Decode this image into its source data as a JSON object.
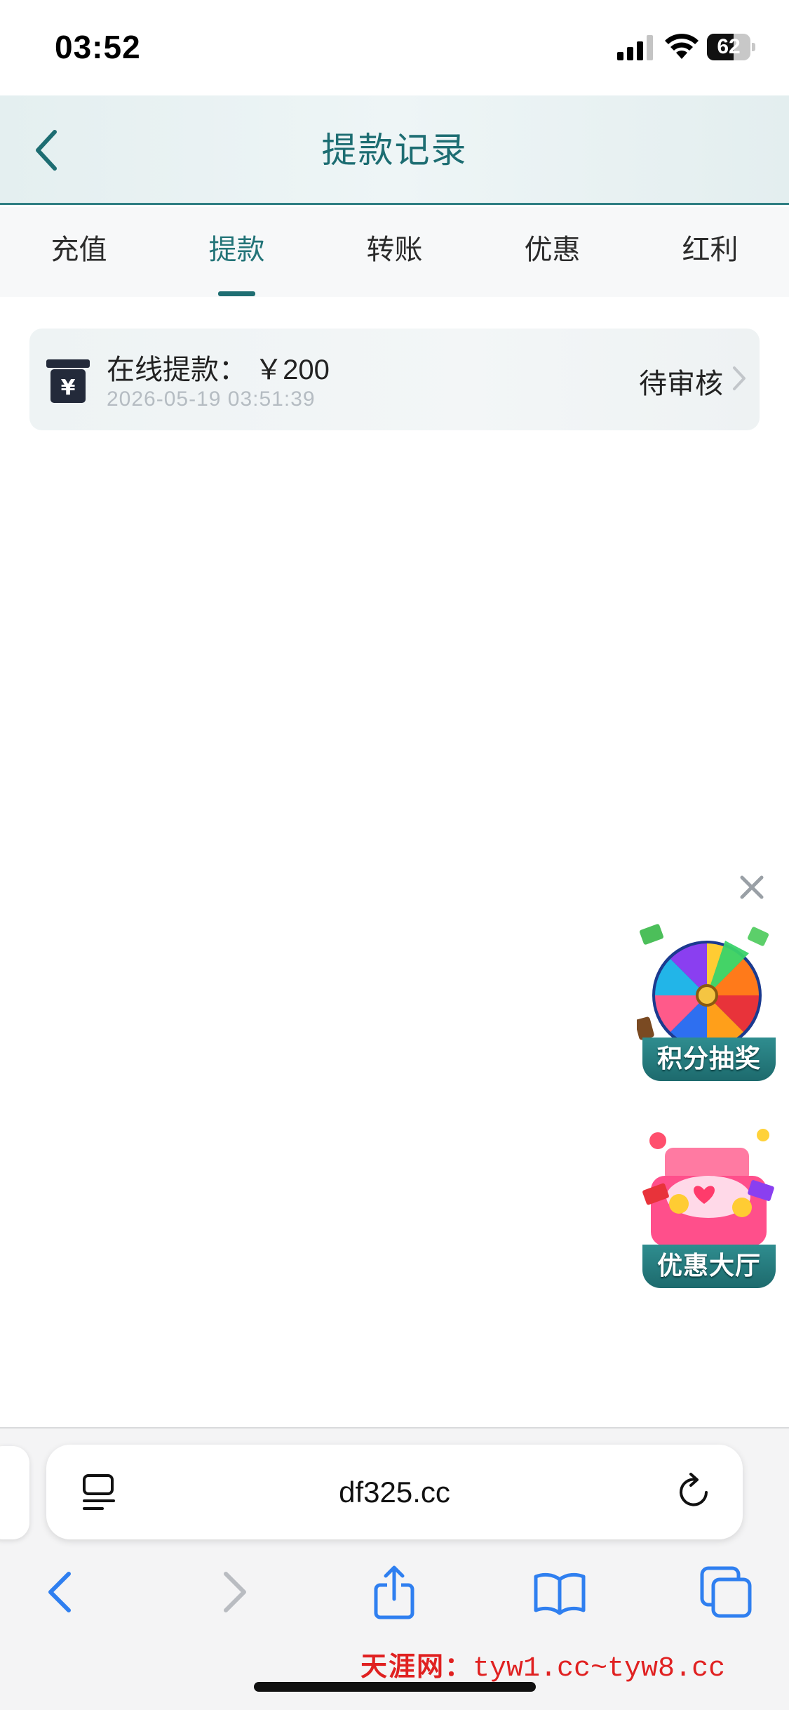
{
  "status_bar": {
    "time": "03:52",
    "battery_percent": 62,
    "battery_label": "62"
  },
  "header": {
    "title": "提款记录"
  },
  "tabs": [
    {
      "label": "充值",
      "active": false
    },
    {
      "label": "提款",
      "active": true
    },
    {
      "label": "转账",
      "active": false
    },
    {
      "label": "优惠",
      "active": false
    },
    {
      "label": "红利",
      "active": false
    }
  ],
  "records": [
    {
      "title": "在线提款： ￥200",
      "time": "2026-05-19 03:51:39",
      "status": "待审核"
    }
  ],
  "promos": {
    "wheel_label": "积分抽奖",
    "hall_label": "优惠大厅"
  },
  "browser": {
    "url": "df325.cc"
  },
  "watermark": {
    "cn": "天涯网：",
    "en": "tyw1.cc~tyw8.cc"
  },
  "colors": {
    "accent": "#1d6d72",
    "header_bg": "#e4eff0",
    "browser_blue": "#2f7ff0",
    "watermark": "#e02121"
  }
}
